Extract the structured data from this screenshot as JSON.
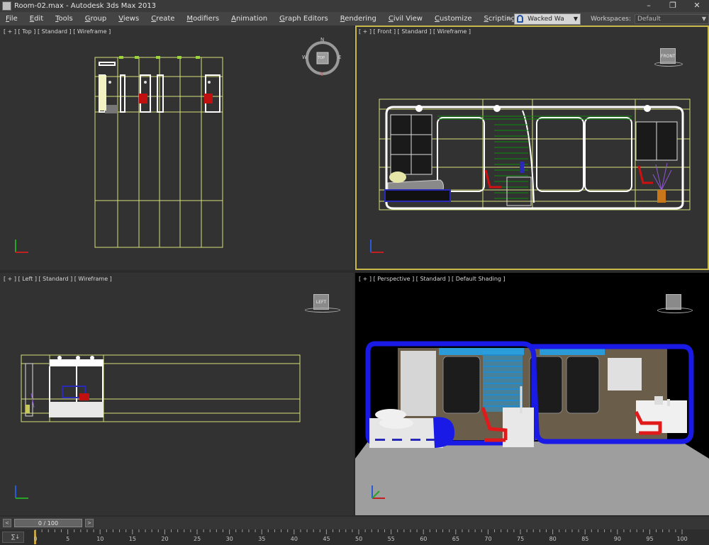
{
  "window": {
    "title": "Room-02.max - Autodesk 3ds Max 2013",
    "controls": [
      "–",
      "❐",
      "✕"
    ]
  },
  "menu": [
    "File",
    "Edit",
    "Tools",
    "Group",
    "Views",
    "Create",
    "Modifiers",
    "Animation",
    "Graph Editors",
    "Rendering",
    "Civil View",
    "Customize",
    "Scripting"
  ],
  "account": {
    "chevrons": "»",
    "user_label": "Wacked Wa",
    "workspaces_label": "Workspaces:",
    "workspace_value": "Default"
  },
  "viewports": {
    "top": {
      "label": "[ + ] [ Top ] [ Standard ] [ Wireframe ]",
      "compass": {
        "n": "N",
        "s": "S",
        "e": "E",
        "w": "W",
        "cube": "TOP"
      }
    },
    "front": {
      "label": "[ + ] [ Front ] [ Standard ] [ Wireframe ]",
      "cube": "FRONT"
    },
    "left": {
      "label": "[ + ] [ Left ] [ Standard ] [ Wireframe ]",
      "cube": "LEFT"
    },
    "perspective": {
      "label": "[ + ] [ Perspective ] [ Standard ] [ Default Shading ]",
      "cube": ""
    }
  },
  "timeline": {
    "slider_label": "0 / 100",
    "prev": "<",
    "next": ">"
  },
  "ruler": {
    "key_label": "∑↓",
    "ticks": [
      "0",
      "5",
      "10",
      "15",
      "20",
      "25",
      "30",
      "35",
      "40",
      "45",
      "50",
      "55",
      "60",
      "65",
      "70",
      "75",
      "80",
      "85",
      "90",
      "95",
      "100"
    ]
  },
  "colors": {
    "wire": "#d8e07a",
    "selected_outline": "#c9b84a",
    "accent_blue": "#1a1ae6",
    "plant_green": "#0e8a0e",
    "chair_red": "#d01010"
  }
}
